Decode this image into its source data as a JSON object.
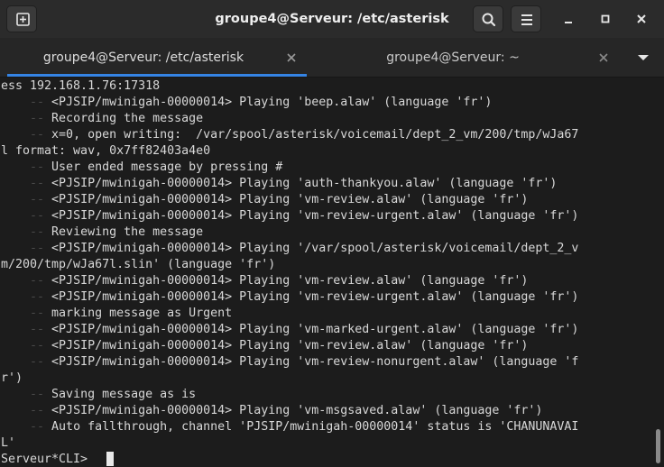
{
  "window": {
    "title": "groupe4@Serveur: /etc/asterisk"
  },
  "header": {
    "new_tab_icon": "new-tab-icon",
    "search_icon": "search-icon",
    "menu_icon": "hamburger-menu-icon",
    "minimize_icon": "minimize-icon",
    "maximize_icon": "maximize-icon",
    "close_icon": "close-icon"
  },
  "tabs": [
    {
      "label": "groupe4@Serveur: /etc/asterisk",
      "active": true
    },
    {
      "label": "groupe4@Serveur: ~",
      "active": false
    }
  ],
  "colors": {
    "accent": "#3584e4",
    "terminal_bg": "#1c1c1c",
    "terminal_fg": "#d8d8d8"
  },
  "terminal": {
    "lines": [
      {
        "indent": "",
        "text": "ess 192.168.1.76:17318"
      },
      {
        "indent": "    -- ",
        "text": "<PJSIP/mwinigah-00000014> Playing 'beep.alaw' (language 'fr')"
      },
      {
        "indent": "    -- ",
        "text": "Recording the message"
      },
      {
        "indent": "    -- ",
        "text": "x=0, open writing:  /var/spool/asterisk/voicemail/dept_2_vm/200/tmp/wJa67"
      },
      {
        "indent": "",
        "text": "l format: wav, 0x7ff82403a4e0"
      },
      {
        "indent": "    -- ",
        "text": "User ended message by pressing #"
      },
      {
        "indent": "    -- ",
        "text": "<PJSIP/mwinigah-00000014> Playing 'auth-thankyou.alaw' (language 'fr')"
      },
      {
        "indent": "    -- ",
        "text": "<PJSIP/mwinigah-00000014> Playing 'vm-review.alaw' (language 'fr')"
      },
      {
        "indent": "    -- ",
        "text": "<PJSIP/mwinigah-00000014> Playing 'vm-review-urgent.alaw' (language 'fr')"
      },
      {
        "indent": "    -- ",
        "text": "Reviewing the message"
      },
      {
        "indent": "    -- ",
        "text": "<PJSIP/mwinigah-00000014> Playing '/var/spool/asterisk/voicemail/dept_2_v"
      },
      {
        "indent": "",
        "text": "m/200/tmp/wJa67l.slin' (language 'fr')"
      },
      {
        "indent": "    -- ",
        "text": "<PJSIP/mwinigah-00000014> Playing 'vm-review.alaw' (language 'fr')"
      },
      {
        "indent": "    -- ",
        "text": "<PJSIP/mwinigah-00000014> Playing 'vm-review-urgent.alaw' (language 'fr')"
      },
      {
        "indent": "    -- ",
        "text": "marking message as Urgent"
      },
      {
        "indent": "    -- ",
        "text": "<PJSIP/mwinigah-00000014> Playing 'vm-marked-urgent.alaw' (language 'fr')"
      },
      {
        "indent": "    -- ",
        "text": "<PJSIP/mwinigah-00000014> Playing 'vm-review.alaw' (language 'fr')"
      },
      {
        "indent": "    -- ",
        "text": "<PJSIP/mwinigah-00000014> Playing 'vm-review-nonurgent.alaw' (language 'f"
      },
      {
        "indent": "",
        "text": "r')"
      },
      {
        "indent": "    -- ",
        "text": "Saving message as is"
      },
      {
        "indent": "    -- ",
        "text": "<PJSIP/mwinigah-00000014> Playing 'vm-msgsaved.alaw' (language 'fr')"
      },
      {
        "indent": "    -- ",
        "text": "Auto fallthrough, channel 'PJSIP/mwinigah-00000014' status is 'CHANUNAVAI"
      },
      {
        "indent": "",
        "text": "L'"
      },
      {
        "indent": "",
        "text": "Serveur*CLI> "
      }
    ]
  }
}
